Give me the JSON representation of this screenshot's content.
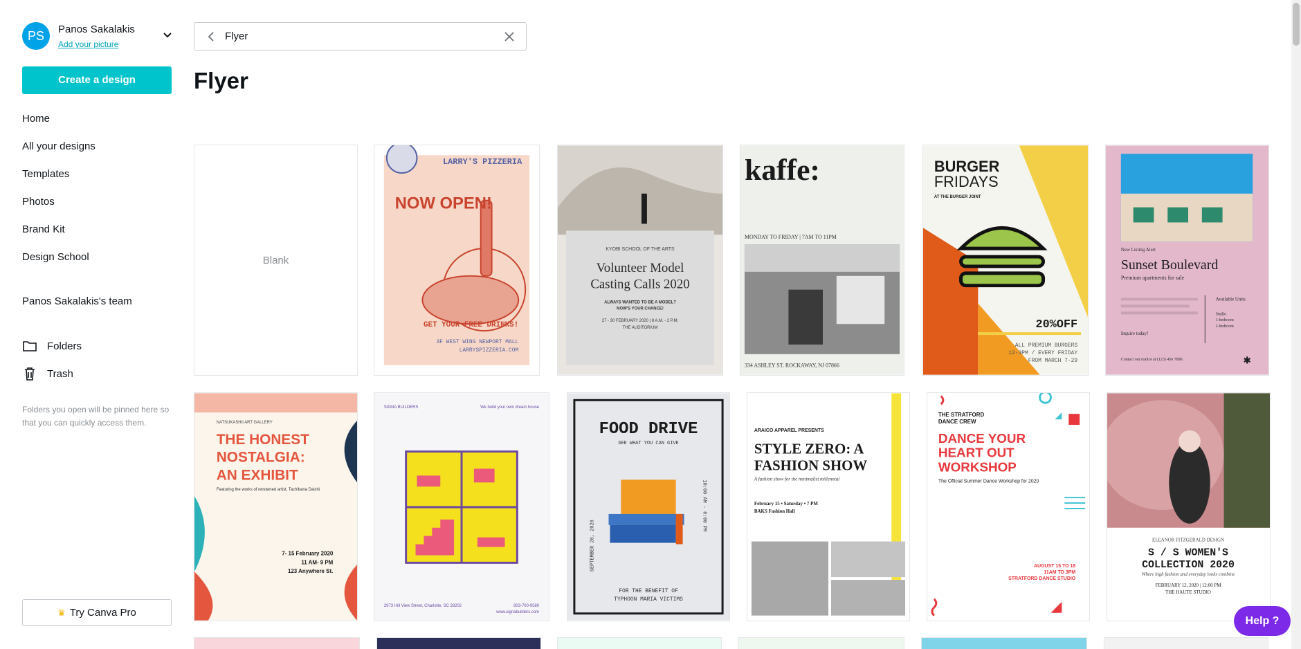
{
  "account": {
    "initials": "PS",
    "name": "Panos Sakalakis",
    "add_picture": "Add your picture",
    "avatar_color": "#00a3e8"
  },
  "create_button": "Create a design",
  "nav": [
    "Home",
    "All your designs",
    "Templates",
    "Photos",
    "Brand Kit",
    "Design School"
  ],
  "team": "Panos Sakalakis's team",
  "folders_label": "Folders",
  "trash_label": "Trash",
  "folders_hint": "Folders you open will be pinned here so that you can quickly access them.",
  "try_pro": "Try Canva Pro",
  "search": {
    "value": "Flyer",
    "back_icon": "chevron-left-icon",
    "clear_icon": "close-icon"
  },
  "page_title": "Flyer",
  "blank_label": "Blank",
  "help_label": "Help ?",
  "colors": {
    "accent": "#00c4cc",
    "help": "#7d2ae8",
    "link": "#00a3b5"
  },
  "templates": {
    "pizzeria": {
      "brand": "LARRY'S PIZZERIA",
      "headline": "NOW OPEN!",
      "cta": "GET YOUR FREE DRINKS!",
      "address": "3F WEST WING NEWPORT MALL",
      "web": "LARRYSPIZZERIA.COM"
    },
    "casting": {
      "school": "KYOBI SCHOOL OF THE ARTS",
      "title1": "Volunteer Model",
      "title2": "Casting Calls 2020",
      "sub1": "ALWAYS WANTED TO BE A MODEL?",
      "sub2": "NOW'S YOUR CHANCE!",
      "date": "27 - 30 FEBRUARY 2020 | 8 A.M. - 2 P.M.",
      "venue": "THE AUDITORIUM"
    },
    "kaffe": {
      "title": "kaffe:",
      "hours": "MONDAY TO FRIDAY | 7AM TO 11PM",
      "address": "334 ASHLEY ST.  ROCKAWAY, NJ 07866"
    },
    "burger": {
      "title1": "BURGER",
      "title2": "FRIDAYS",
      "sub": "AT THE BURGER JOINT",
      "offer": "20%OFF",
      "line1": "ALL PREMIUM BURGERS",
      "line2": "12-3PM / EVERY FRIDAY",
      "line3": "FROM MARCH 7-29"
    },
    "sunset": {
      "alert": "New Listing Alert",
      "title": "Sunset Boulevard",
      "sub": "Premium apartments for sale",
      "units": "Available Units",
      "studio": "Studio",
      "b1": "1-bedroom",
      "b2": "2-bedroom",
      "inquire": "Inquire today!",
      "contact": "Contact our realtor at (123) 456 7890."
    },
    "nostalgia": {
      "gallery": "NATSUKASHII ART GALLERY",
      "t1": "THE HONEST",
      "t2": "NOSTALGIA:",
      "t3": "AN EXHIBIT",
      "sub": "Featuring the works of renowned artist, Tachibana Daishi",
      "d1": "7- 15 February 2020",
      "d2": "11 AM- 9 PM",
      "d3": "123 Anywhere St."
    },
    "signa": {
      "brand": "SIGNA BUILDERS",
      "tag": "We build your own dream house",
      "addr": "2973 Hill View Street, Charlotte, SC 28202",
      "phone": "803-700-9580",
      "web": "www.signabuilders.com"
    },
    "food": {
      "title": "FOOD DRIVE",
      "sub": "SEE WHAT YOU CAN GIVE",
      "date": "SEPTEMBER 28, 2028",
      "time": "10:00 AM - 6:00 PM",
      "f1": "FOR THE BENEFIT OF",
      "f2": "TYPHOON MARIA VICTIMS"
    },
    "style": {
      "pre": "ARAICO APPAREL PRESENTS",
      "t1": "STYLE ZERO: A",
      "t2": "FASHION SHOW",
      "sub": "A fashion show for the minimalist millennial",
      "date": "February 15 • Saturday • 7 PM",
      "venue": "BAKS Fashion Hall"
    },
    "dance": {
      "crew1": "THE STRATFORD",
      "crew2": "DANCE CREW",
      "t1": "DANCE YOUR",
      "t2": "HEART OUT",
      "t3": "WORKSHOP",
      "sub": "The Official Summer Dance Workshop for 2020",
      "date": "AUGUST 15 TO 18",
      "time": "11AM TO 3PM",
      "place": "STRATFORD DANCE STUDIO"
    },
    "women": {
      "designer": "ELEANOR FITZGERALD DESIGN",
      "t1": "S / S WOMEN'S",
      "t2": "COLLECTION 2020",
      "sub": "Where high fashion and everyday looks combine",
      "date": "FEBRUARY 12, 2020 | 12:00 PM",
      "venue": "THE HAUTE STUDIO"
    }
  }
}
